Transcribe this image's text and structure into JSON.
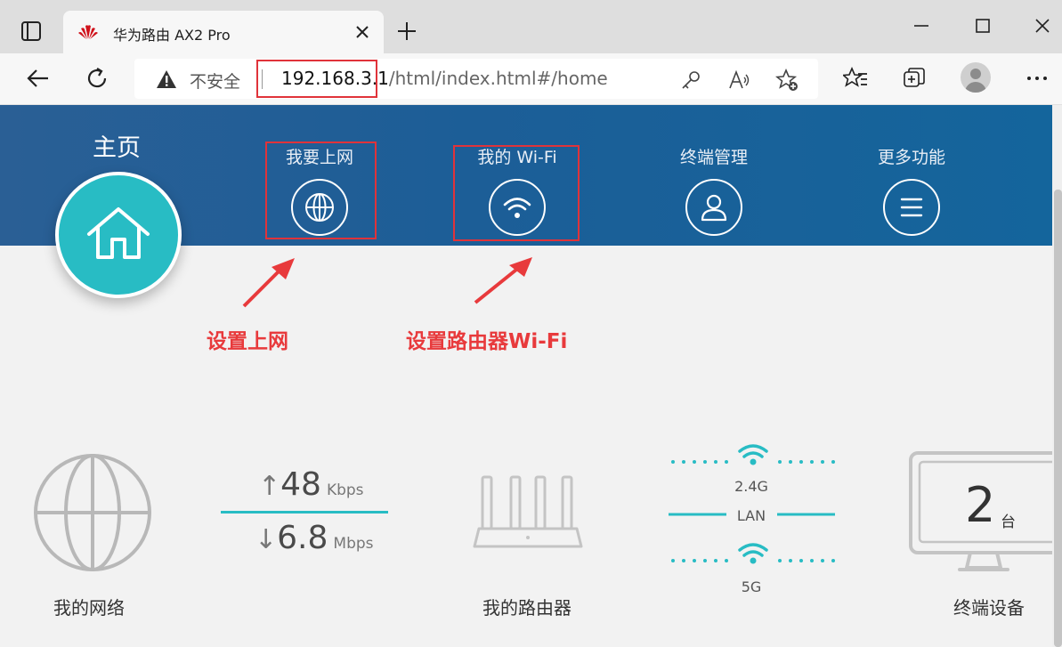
{
  "browser": {
    "tab_title": "华为路由 AX2 Pro",
    "security_text": "不安全",
    "url_host": "192.168.3.1",
    "url_path": "/html/index.html#/home"
  },
  "header": {
    "home_label": "主页",
    "nav": [
      {
        "label": "我要上网",
        "icon": "globe-icon"
      },
      {
        "label": "我的 Wi-Fi",
        "icon": "wifi-icon"
      },
      {
        "label": "终端管理",
        "icon": "user-icon"
      },
      {
        "label": "更多功能",
        "icon": "menu-icon"
      }
    ]
  },
  "annotations": {
    "internet": "设置上网",
    "wifi": "设置路由器Wi-Fi"
  },
  "dashboard": {
    "network_label": "我的网络",
    "upload_value": "48",
    "upload_unit": "Kbps",
    "download_value": "6.8",
    "download_unit": "Mbps",
    "router_label": "我的路由器",
    "band_24": "2.4G",
    "band_lan": "LAN",
    "band_5": "5G",
    "device_count": "2",
    "device_unit": "台",
    "devices_label": "终端设备"
  },
  "colors": {
    "header_blue": "#1c5e97",
    "teal": "#28bcc4",
    "annotation_red": "#e83a3c"
  }
}
